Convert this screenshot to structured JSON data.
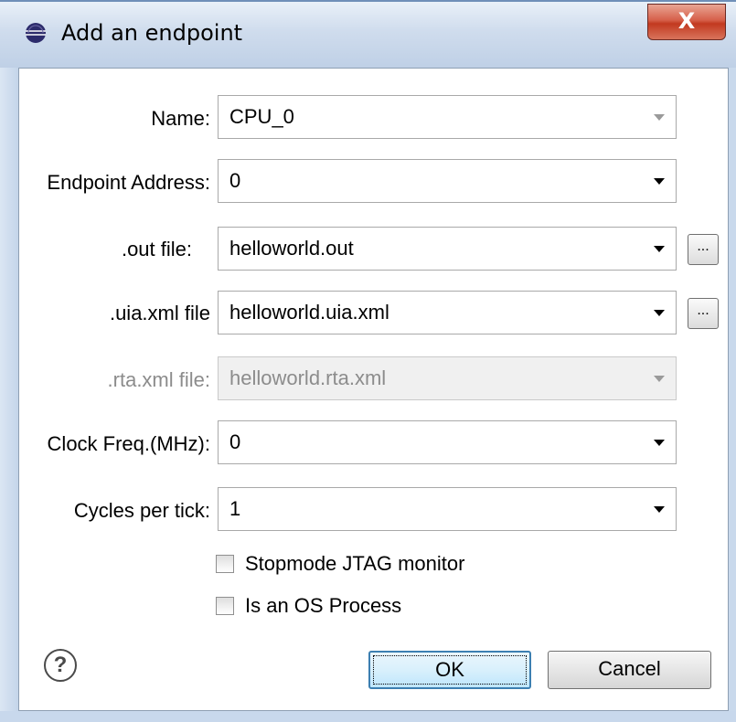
{
  "window": {
    "title": "Add an endpoint",
    "close_label": "X"
  },
  "form": {
    "name": {
      "label": "Name:",
      "value": "CPU_0"
    },
    "endpoint_address": {
      "label": "Endpoint Address:",
      "value": "0"
    },
    "out_file": {
      "label": ".out file:",
      "value": "helloworld.out",
      "browse_label": "..."
    },
    "uia_xml_file": {
      "label": ".uia.xml file",
      "value": "helloworld.uia.xml",
      "browse_label": "..."
    },
    "rta_xml_file": {
      "label": ".rta.xml file:",
      "value": "helloworld.rta.xml",
      "disabled": true
    },
    "clock_freq": {
      "label": "Clock Freq.(MHz):",
      "value": "0"
    },
    "cycles_per_tick": {
      "label": "Cycles per tick:",
      "value": "1"
    },
    "stopmode_jtag": {
      "label": "Stopmode JTAG monitor",
      "checked": false
    },
    "is_os_process": {
      "label": "Is an OS Process",
      "checked": false
    }
  },
  "buttons": {
    "help_label": "?",
    "ok_label": "OK",
    "cancel_label": "Cancel"
  },
  "icons": {
    "title_icon": "eclipse-icon",
    "close_icon": "close-icon",
    "help_icon": "help-icon",
    "dropdown_icon": "chevron-down-icon"
  }
}
